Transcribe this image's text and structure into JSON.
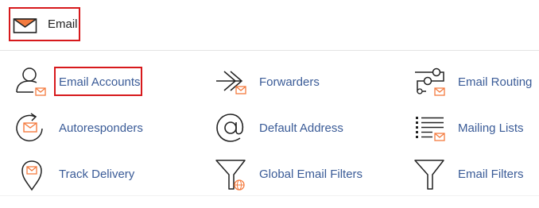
{
  "section": {
    "title": "Email",
    "icon": "envelope-icon"
  },
  "items": [
    {
      "label": "Email Accounts",
      "icon": "user-envelope-icon"
    },
    {
      "label": "Forwarders",
      "icon": "forward-arrow-envelope-icon"
    },
    {
      "label": "Email Routing",
      "icon": "routing-envelope-icon"
    },
    {
      "label": "Autoresponders",
      "icon": "refresh-envelope-icon"
    },
    {
      "label": "Default Address",
      "icon": "at-sign-icon"
    },
    {
      "label": "Mailing Lists",
      "icon": "list-envelope-icon"
    },
    {
      "label": "Track Delivery",
      "icon": "map-pin-envelope-icon"
    },
    {
      "label": "Global Email Filters",
      "icon": "funnel-globe-icon"
    },
    {
      "label": "Email Filters",
      "icon": "funnel-icon"
    }
  ],
  "colors": {
    "accent": "#f47b3f",
    "link": "#3a5b97",
    "highlight": "#d7191c",
    "icon_stroke": "#222222"
  }
}
